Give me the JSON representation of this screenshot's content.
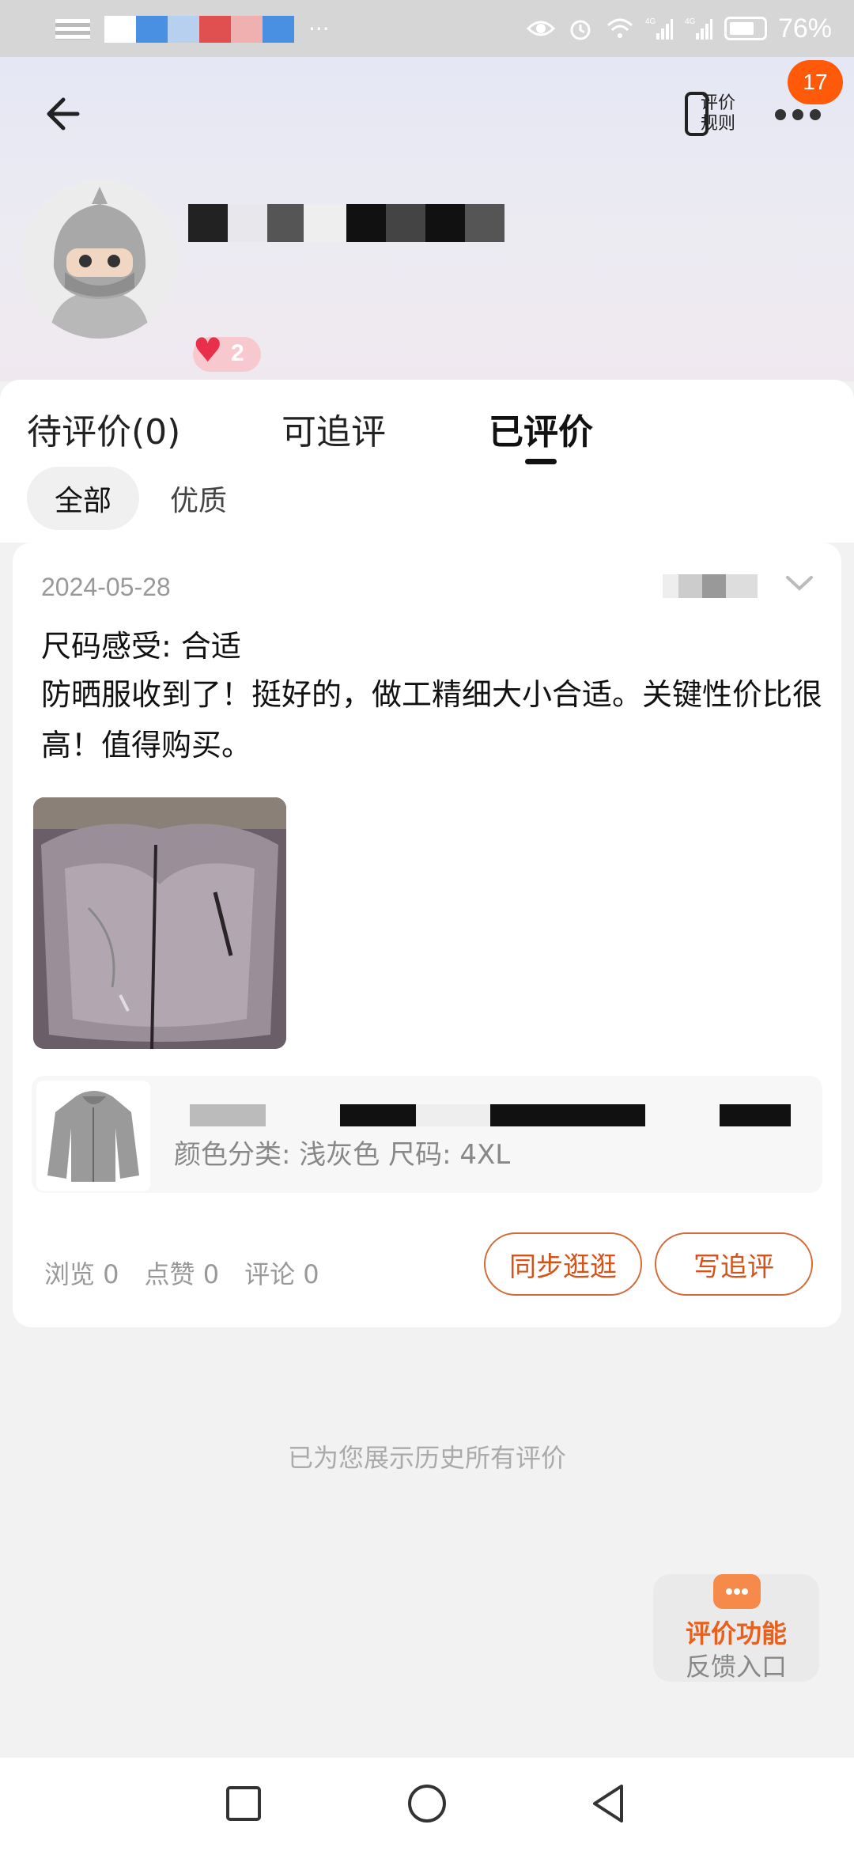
{
  "status_bar": {
    "battery": "76%",
    "network_1": "4G",
    "network_2": "4G",
    "icons": [
      "notification-icon",
      "eye-icon",
      "alarm-icon",
      "wifi-icon",
      "signal-icon",
      "signal-icon",
      "battery-icon"
    ]
  },
  "header": {
    "back_icon": "arrow-left-icon",
    "rules_label_1": "评价",
    "rules_label_2": "规则",
    "more_icon": "more-dots-icon",
    "notification_count": "17",
    "like_count": "2"
  },
  "tabs": [
    {
      "label": "待评价(0)",
      "active": false
    },
    {
      "label": "可追评",
      "active": false
    },
    {
      "label": "已评价",
      "active": true
    }
  ],
  "filters": [
    {
      "label": "全部",
      "selected": true
    },
    {
      "label": "优质",
      "selected": false
    }
  ],
  "review_card": {
    "date": "2024-05-28",
    "size_feel": "尺码感受: 合适",
    "text": "防晒服收到了！挺好的，做工精细大小合适。关键性价比很高！值得购买。",
    "product_spec": "颜色分类: 浅灰色 尺码: 4XL",
    "stats": {
      "views": "浏览 0",
      "likes": "点赞 0",
      "comments": "评论 0"
    },
    "buttons": {
      "sync": "同步逛逛",
      "append": "写追评"
    }
  },
  "footer_note": "已为您展示历史所有评价",
  "feedback_fab": {
    "line1": "评价功能",
    "line2": "反馈入口"
  },
  "colors": {
    "accent": "#ff5a0a",
    "button_border": "#d56a36",
    "fab_title": "#e8601e"
  }
}
